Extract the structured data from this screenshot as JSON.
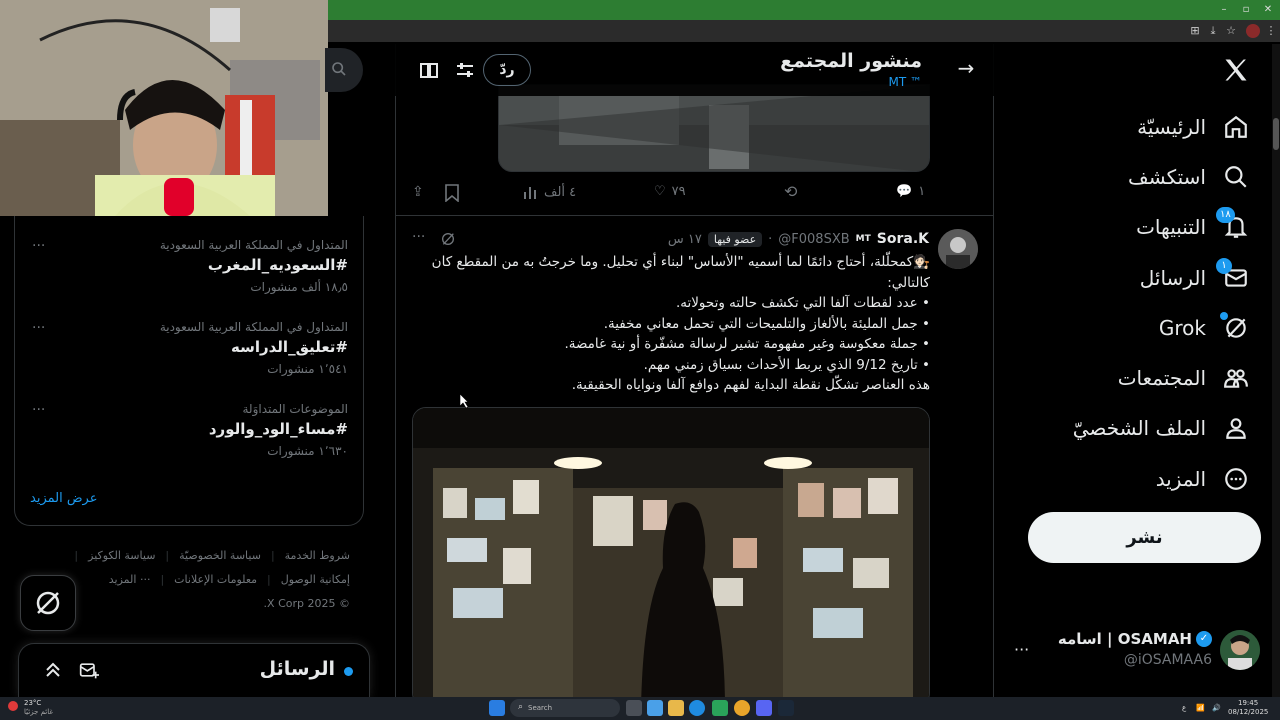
{
  "nav": {
    "home": "الرئيسيّة",
    "explore": "استكشف",
    "notifications": "التنبيهات",
    "notifications_badge": "١٨",
    "messages": "الرسائل",
    "messages_badge": "١",
    "grok": "Grok",
    "communities": "المجتمعات",
    "profile": "الملف الشخصيّ",
    "more": "المزيد",
    "post_button": "نشر"
  },
  "account": {
    "name": "اسامه | OSAMAH",
    "handle": "@iOSAMAA6",
    "more": "···"
  },
  "header": {
    "title": "منشور المجتمع",
    "subtitle": "MT ™",
    "reply_button": "ردّ"
  },
  "prev_post_actions": {
    "replies": "١",
    "likes": "٧٩",
    "views": "٤ ألف"
  },
  "post": {
    "author": "Sora.K",
    "author_tag": "MT",
    "handle": "@F008SXB",
    "member_badge": "عضو فيها",
    "time": "١٧ س",
    "line1": "🧑🏻‍⚖️كمحلّلة، أحتاج دائمًا لما أسميه \"الأساس\" لبناء أي تحليل. وما خرجتُ به من المقطع كان كالتالي:",
    "bullet1": "• عدد لقطات آلفا التي تكشف حالته وتحولاته.",
    "bullet2": "• جمل المليئة بالألغاز والتلميحات التي تحمل معاني مخفية.",
    "bullet3": "• جملة معكوسة وغير مفهومة تشير لرسالة مشفّرة أو نية غامضة.",
    "bullet4": "• تاريخ 9/12 الذي يربط الأحداث بسياق زمني مهم.",
    "line_end": "هذه العناصر تشكّل نقطة البداية لفهم دوافع آلفا ونواياه الحقيقية."
  },
  "trends": [
    {
      "context": "المتداول في المملكة العربية السعودية",
      "tag": "#السعوديه_المغرب",
      "count": "١٨٫٥ ألف منشورات"
    },
    {
      "context": "المتداول في المملكة العربية السعودية",
      "tag": "#تعليق_الدراسه",
      "count": "١٬٥٤١ منشورات"
    },
    {
      "context": "الموضوعات المتداوَلة",
      "tag": "#مساء_الود_والورد",
      "count": "١٬٦٣٠ منشورات"
    }
  ],
  "trends_show_more": "عرض المزيد",
  "footer": {
    "terms": "شروط الخدمة",
    "privacy": "سياسة الخصوصيّة",
    "cookies": "سياسة الكوكيز",
    "accessibility": "إمكانية الوصول",
    "ads": "معلومات الإعلانات",
    "more": "··· المزيد",
    "copyright": "© 2025 X Corp."
  },
  "messages_drawer": {
    "title": "الرسائل"
  },
  "taskbar": {
    "weather_temp": "23°C",
    "weather_desc": "غائم جزئيًا",
    "search": "Search",
    "time": "19:45",
    "date": "08/12/2025",
    "lang": "ع"
  },
  "colors": {
    "accent": "#1d9bf0",
    "background": "#000000",
    "border": "#2f3336",
    "muted": "#71767b"
  }
}
